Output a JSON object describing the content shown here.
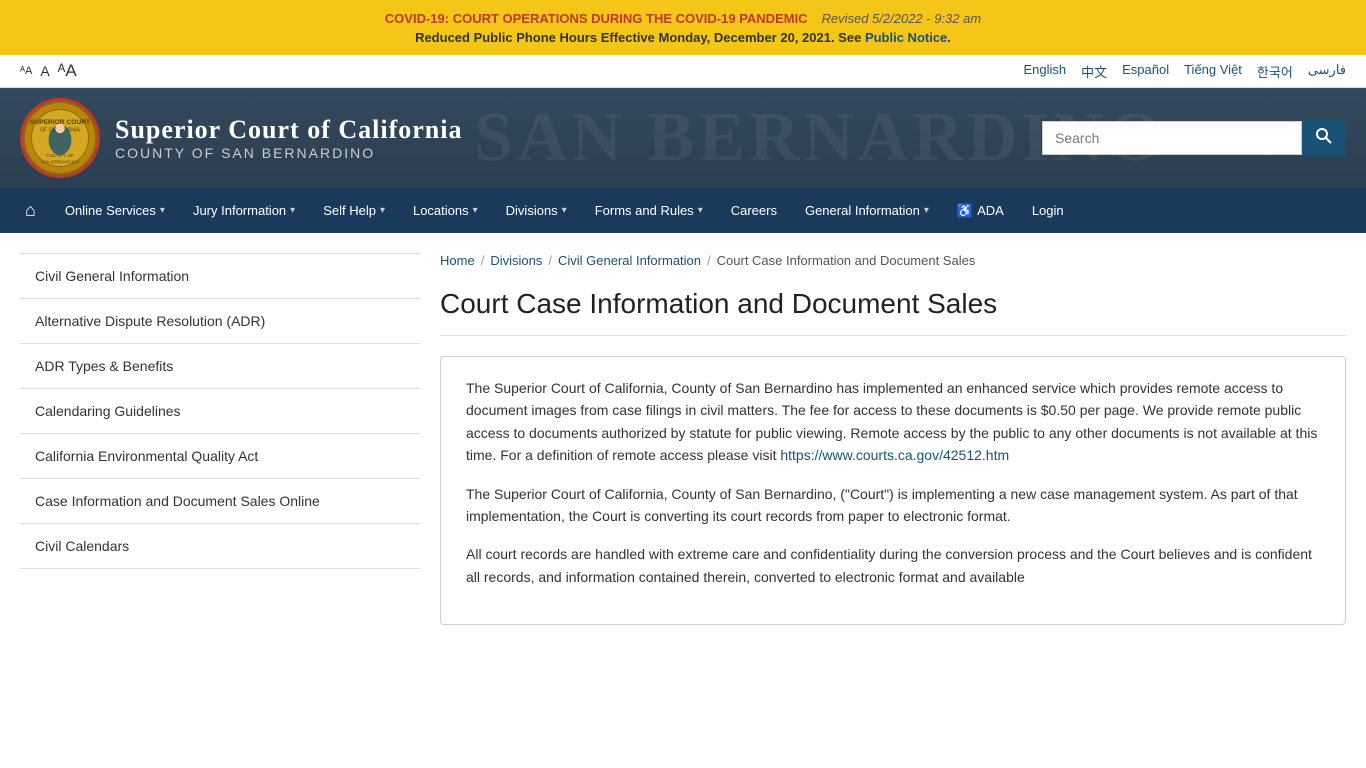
{
  "alert": {
    "covid_title": "COVID-19: COURT OPERATIONS DURING THE COVID-19 PANDEMIC",
    "revised": "Revised 5/2/2022 - 9:32 am",
    "phone_notice": "Reduced Public Phone Hours Effective Monday, December 20, 2021. See",
    "public_notice_link": "Public Notice",
    "phone_notice_end": "."
  },
  "util": {
    "font_small": "↑A",
    "font_medium": "A",
    "font_large": "↑A",
    "languages": [
      "English",
      "中文",
      "Español",
      "Tiếng Việt",
      "한국어",
      "فارسی"
    ]
  },
  "header": {
    "title": "Superior Court of California",
    "subtitle": "County of San Bernardino",
    "search_placeholder": "Search"
  },
  "nav": {
    "home_icon": "⌂",
    "items": [
      {
        "label": "Online Services",
        "has_arrow": true
      },
      {
        "label": "Jury Information",
        "has_arrow": true
      },
      {
        "label": "Self Help",
        "has_arrow": true
      },
      {
        "label": "Locations",
        "has_arrow": true
      },
      {
        "label": "Divisions",
        "has_arrow": true
      },
      {
        "label": "Forms and Rules",
        "has_arrow": true
      },
      {
        "label": "Careers",
        "has_arrow": false
      },
      {
        "label": "General Information",
        "has_arrow": true
      },
      {
        "label": "ADA",
        "has_arrow": false,
        "icon": "♿"
      },
      {
        "label": "Login",
        "has_arrow": false
      }
    ]
  },
  "sidebar": {
    "items": [
      {
        "label": "Civil General Information"
      },
      {
        "label": "Alternative Dispute Resolution (ADR)"
      },
      {
        "label": "ADR Types & Benefits"
      },
      {
        "label": "Calendaring Guidelines"
      },
      {
        "label": "California Environmental Quality Act"
      },
      {
        "label": "Case Information and Document Sales Online"
      },
      {
        "label": "Civil Calendars"
      }
    ]
  },
  "breadcrumb": {
    "home": "Home",
    "divisions": "Divisions",
    "civil": "Civil General Information",
    "current": "Court Case Information and Document Sales"
  },
  "page": {
    "title": "Court Case Information and Document Sales",
    "para1": "The Superior Court of California, County of San Bernardino has implemented an enhanced service which provides remote access to document images from case filings in civil matters. The fee for access to these documents is $0.50 per page. We provide remote public access to documents authorized by statute for public viewing. Remote access by the public to any other documents is not available at this time. For a definition of remote access please visit",
    "link": "https://www.courts.ca.gov/42512.htm",
    "para2": "The Superior Court of California, County of San Bernardino, (\"Court\") is implementing a new case management system. As part of that implementation, the Court is converting its court records from paper to electronic format.",
    "para3": "All court records are handled with extreme care and confidentiality during the conversion process and the Court believes and is confident all records, and information contained therein, converted to electronic format and available"
  }
}
